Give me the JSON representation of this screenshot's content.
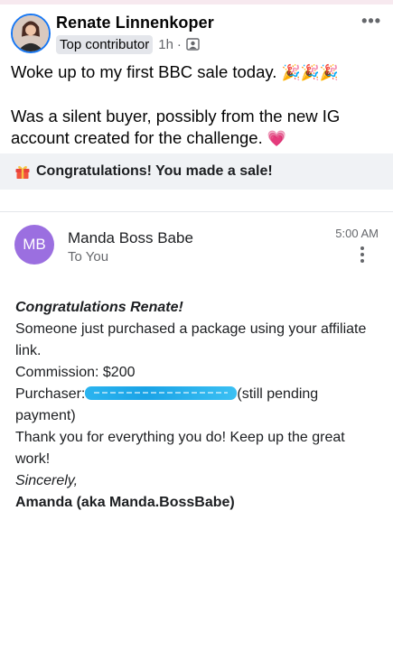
{
  "post": {
    "author": "Renate Linnenkoper",
    "badge": "Top contributor",
    "time": "1h",
    "dot": "·",
    "more": "•••",
    "text_line1": "Woke up to my first BBC sale today.",
    "text_emojis": "🎉🎉🎉",
    "text_line2": "Was a silent buyer, possibly from the new IG account created for the challenge.",
    "heart": "💗",
    "icons": {
      "avatar": "profile-photo",
      "audience": "group-audience-icon",
      "more": "more-options-icon"
    }
  },
  "notification": {
    "text": "Congratulations! You made a sale!",
    "icon": "gift-icon"
  },
  "email": {
    "sender_initials": "MB",
    "sender_name": "Manda Boss Babe",
    "recipient": "To You",
    "time": "5:00 AM",
    "greeting": "Congratulations Renate!",
    "body1": "Someone just purchased a package using your affiliate link.",
    "commission": "Commission: $200",
    "purchaser_label": "Purchaser:",
    "purchaser_suffix": "(still pending payment)",
    "thanks": "Thank you for everything you do! Keep up the great work!",
    "signoff": "Sincerely,",
    "signature": "Amanda (aka Manda.BossBabe)"
  },
  "colors": {
    "accent_blue": "#1877f2",
    "mb_avatar": "#9b6fe0",
    "notif_bg": "#f0f2f5",
    "redaction": "#1aa3e6"
  }
}
